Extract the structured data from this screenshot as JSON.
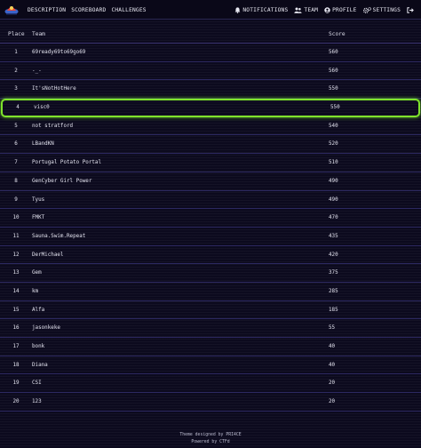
{
  "nav": {
    "links": [
      "DESCRIPTION",
      "SCOREBOARD",
      "CHALLENGES"
    ],
    "right": [
      {
        "label": "NOTIFICATIONS",
        "icon": "bell-icon"
      },
      {
        "label": "TEAM",
        "icon": "users-icon"
      },
      {
        "label": "PROFILE",
        "icon": "user-circle-icon"
      },
      {
        "label": "SETTINGS",
        "icon": "gears-icon"
      }
    ],
    "logout_icon": "logout-icon"
  },
  "table": {
    "headers": {
      "place": "Place",
      "team": "Team",
      "score": "Score"
    },
    "rows": [
      {
        "place": "1",
        "team": "69ready69to69go69",
        "score": "560"
      },
      {
        "place": "2",
        "team": "-_-",
        "score": "560"
      },
      {
        "place": "3",
        "team": "It'sNotHotHere",
        "score": "550"
      },
      {
        "place": "4",
        "team": "visc0",
        "score": "550"
      },
      {
        "place": "5",
        "team": "not stratford",
        "score": "540"
      },
      {
        "place": "6",
        "team": "LBandKN",
        "score": "520"
      },
      {
        "place": "7",
        "team": "Portugal Potato Portal",
        "score": "510"
      },
      {
        "place": "8",
        "team": "GenCyber Girl Power",
        "score": "490"
      },
      {
        "place": "9",
        "team": "Tyus",
        "score": "490"
      },
      {
        "place": "10",
        "team": "FMKT",
        "score": "470"
      },
      {
        "place": "11",
        "team": "Sauna.Swim.Repeat",
        "score": "435"
      },
      {
        "place": "12",
        "team": "DerMichael",
        "score": "420"
      },
      {
        "place": "13",
        "team": "Gem",
        "score": "375"
      },
      {
        "place": "14",
        "team": "km",
        "score": "285"
      },
      {
        "place": "15",
        "team": "Alfa",
        "score": "185"
      },
      {
        "place": "16",
        "team": "jasonkeke",
        "score": "55"
      },
      {
        "place": "17",
        "team": "bonk",
        "score": "40"
      },
      {
        "place": "18",
        "team": "Diana",
        "score": "40"
      },
      {
        "place": "19",
        "team": "CSI",
        "score": "20"
      },
      {
        "place": "20",
        "team": "123",
        "score": "20"
      }
    ],
    "highlight_place": "4",
    "highlight_color": "#7fe32c"
  },
  "footer": {
    "line1": "Theme designed by PRI4CE",
    "line2": "Powered by CTFd"
  }
}
